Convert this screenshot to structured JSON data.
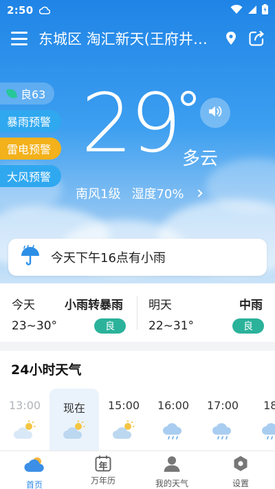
{
  "status_bar": {
    "time": "2:50"
  },
  "header": {
    "location": "东城区 淘汇新天(王府井…"
  },
  "hero": {
    "aqi": "良63",
    "warnings": [
      "暴雨预警",
      "雷电预警",
      "大风预警"
    ],
    "temperature": "29",
    "condition": "多云",
    "wind": "南风1级",
    "humidity": "湿度70%"
  },
  "alert": {
    "text": "今天下午16点有小雨"
  },
  "forecast": {
    "today": {
      "label": "今天",
      "condition": "小雨转暴雨",
      "range": "23~30°",
      "aqi": "良"
    },
    "tomorrow": {
      "label": "明天",
      "condition": "中雨",
      "range": "22~31°",
      "aqi": "良"
    }
  },
  "hourly": {
    "title": "24小时天气",
    "hours": [
      {
        "time": "13:00",
        "icon": "partly-cloudy-icon"
      },
      {
        "time": "现在",
        "icon": "partly-cloudy-icon"
      },
      {
        "time": "15:00",
        "icon": "partly-cloudy-icon"
      },
      {
        "time": "16:00",
        "icon": "rain-cloud-icon"
      },
      {
        "time": "17:00",
        "icon": "rain-cloud-icon"
      },
      {
        "time": "18:",
        "icon": "rain-cloud-icon"
      }
    ]
  },
  "nav": {
    "items": [
      {
        "label": "首页",
        "icon": "home-weather-icon"
      },
      {
        "label": "万年历",
        "icon": "calendar-icon",
        "icon_text": "年"
      },
      {
        "label": "我的天气",
        "icon": "profile-icon"
      },
      {
        "label": "设置",
        "icon": "settings-icon"
      }
    ]
  },
  "colors": {
    "sky_top": "#1f84e6",
    "aqi_good": "#2bb29b",
    "warning_blue": "#2fa8f0",
    "warning_yellow": "#f3b11b",
    "nav_active": "#2f8ae8"
  }
}
